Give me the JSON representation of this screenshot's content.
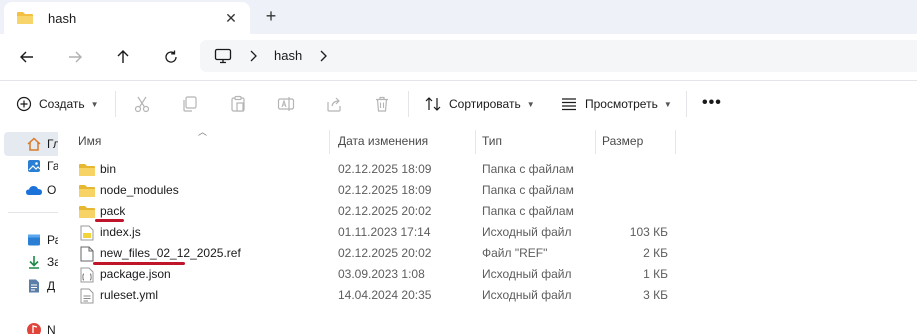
{
  "tab": {
    "title": "hash",
    "close_glyph": "✕",
    "new_tab_glyph": "+"
  },
  "address": {
    "segment": "hash"
  },
  "commands": {
    "create": "Создать",
    "sort": "Сортировать",
    "view": "Просмотреть",
    "more": "•••"
  },
  "navpane": {
    "items": [
      {
        "label": "Гл",
        "icon": "home-icon"
      },
      {
        "label": "Га",
        "icon": "gallery-icon"
      },
      {
        "label": "O",
        "icon": "onedrive-icon"
      },
      {
        "label": "Ра",
        "icon": "desktop-icon"
      },
      {
        "label": "За",
        "icon": "downloads-icon"
      },
      {
        "label": "Д",
        "icon": "documents-icon"
      },
      {
        "label": "N",
        "icon": "music-icon"
      }
    ]
  },
  "columns": {
    "name": "Имя",
    "date": "Дата изменения",
    "type": "Тип",
    "size": "Размер"
  },
  "files": [
    {
      "name": "bin",
      "date": "02.12.2025 18:09",
      "type": "Папка с файлами",
      "size": "",
      "icon": "folder-icon"
    },
    {
      "name": "node_modules",
      "date": "02.12.2025 18:09",
      "type": "Папка с файлами",
      "size": "",
      "icon": "folder-icon"
    },
    {
      "name": "pack",
      "date": "02.12.2025 20:02",
      "type": "Папка с файлами",
      "size": "",
      "icon": "folder-icon"
    },
    {
      "name": "index.js",
      "date": "01.11.2023 17:14",
      "type": "Исходный файл J...",
      "size": "103 КБ",
      "icon": "js-file-icon"
    },
    {
      "name": "new_files_02_12_2025.ref",
      "date": "02.12.2025 20:02",
      "type": "Файл \"REF\"",
      "size": "2 КБ",
      "icon": "file-icon"
    },
    {
      "name": "package.json",
      "date": "03.09.2023 1:08",
      "type": "Исходный файл J...",
      "size": "1 КБ",
      "icon": "json-file-icon"
    },
    {
      "name": "ruleset.yml",
      "date": "14.04.2024 20:35",
      "type": "Исходный файл ...",
      "size": "3 КБ",
      "icon": "yml-file-icon"
    }
  ],
  "colors": {
    "folder": "#f2c143",
    "accent": "#0067c0",
    "annotation": "#c0142a"
  }
}
